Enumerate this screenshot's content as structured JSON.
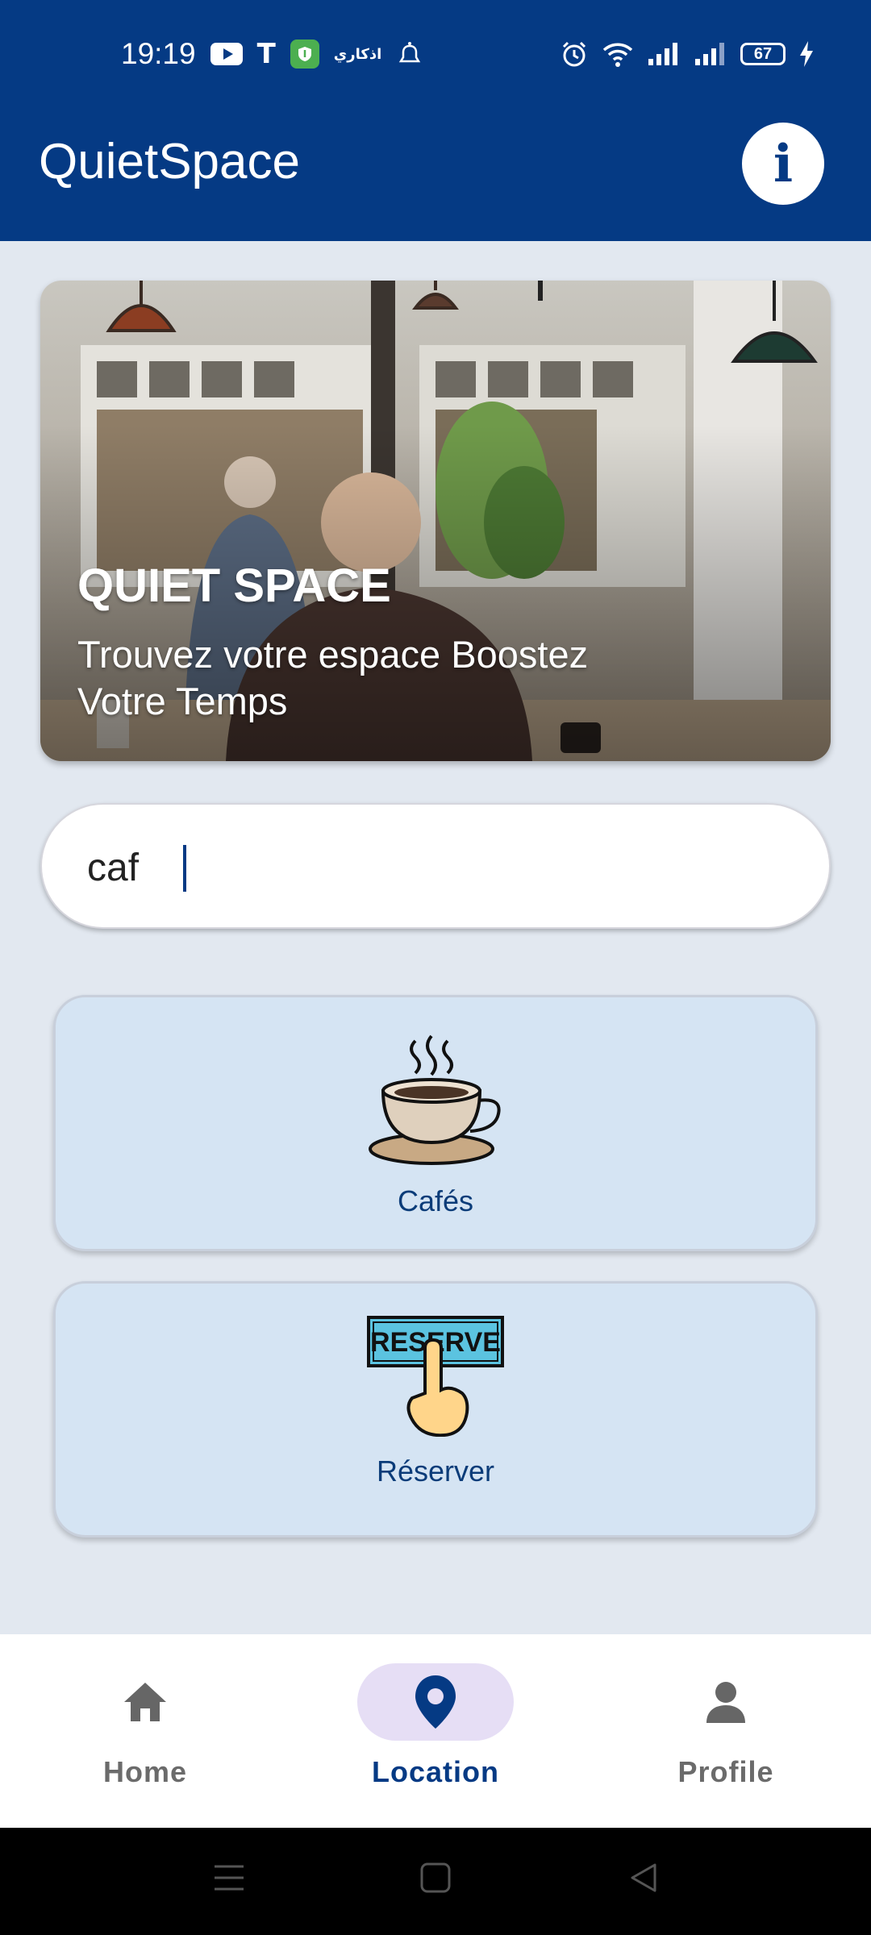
{
  "status_bar": {
    "time": "19:19",
    "t_glyph": "T",
    "arabic_badge": "اذكاري",
    "battery": "67",
    "icons": [
      "youtube-icon",
      "t-icon",
      "vpn-shield-icon",
      "arabic-app-icon",
      "bell-icon",
      "alarm-icon",
      "wifi-icon",
      "signal-icon",
      "signal-icon-2",
      "battery-icon",
      "charging-icon"
    ]
  },
  "app_bar": {
    "title": "QuietSpace",
    "info_icon": "info-icon",
    "info_glyph": "i"
  },
  "hero": {
    "title": "QUIET SPACE",
    "subtitle": "Trouvez votre espace Boostez Votre Temps"
  },
  "search": {
    "value": "caf",
    "placeholder": ""
  },
  "categories": [
    {
      "label": "Cafés",
      "icon": "coffee-cup-icon"
    },
    {
      "label": "Réserver",
      "icon": "reserve-hand-icon",
      "icon_text": "RESERVE"
    }
  ],
  "bottom_nav": {
    "items": [
      {
        "label": "Home",
        "icon": "home-icon",
        "active": false
      },
      {
        "label": "Location",
        "icon": "location-pin-icon",
        "active": true
      },
      {
        "label": "Profile",
        "icon": "person-icon",
        "active": false
      }
    ]
  },
  "system_nav": [
    "menu-icon",
    "home-square-icon",
    "back-icon"
  ],
  "colors": {
    "brand": "#053a84",
    "background": "#e2e8f0",
    "card": "#d5e4f3",
    "active_pill": "#e6def5"
  }
}
